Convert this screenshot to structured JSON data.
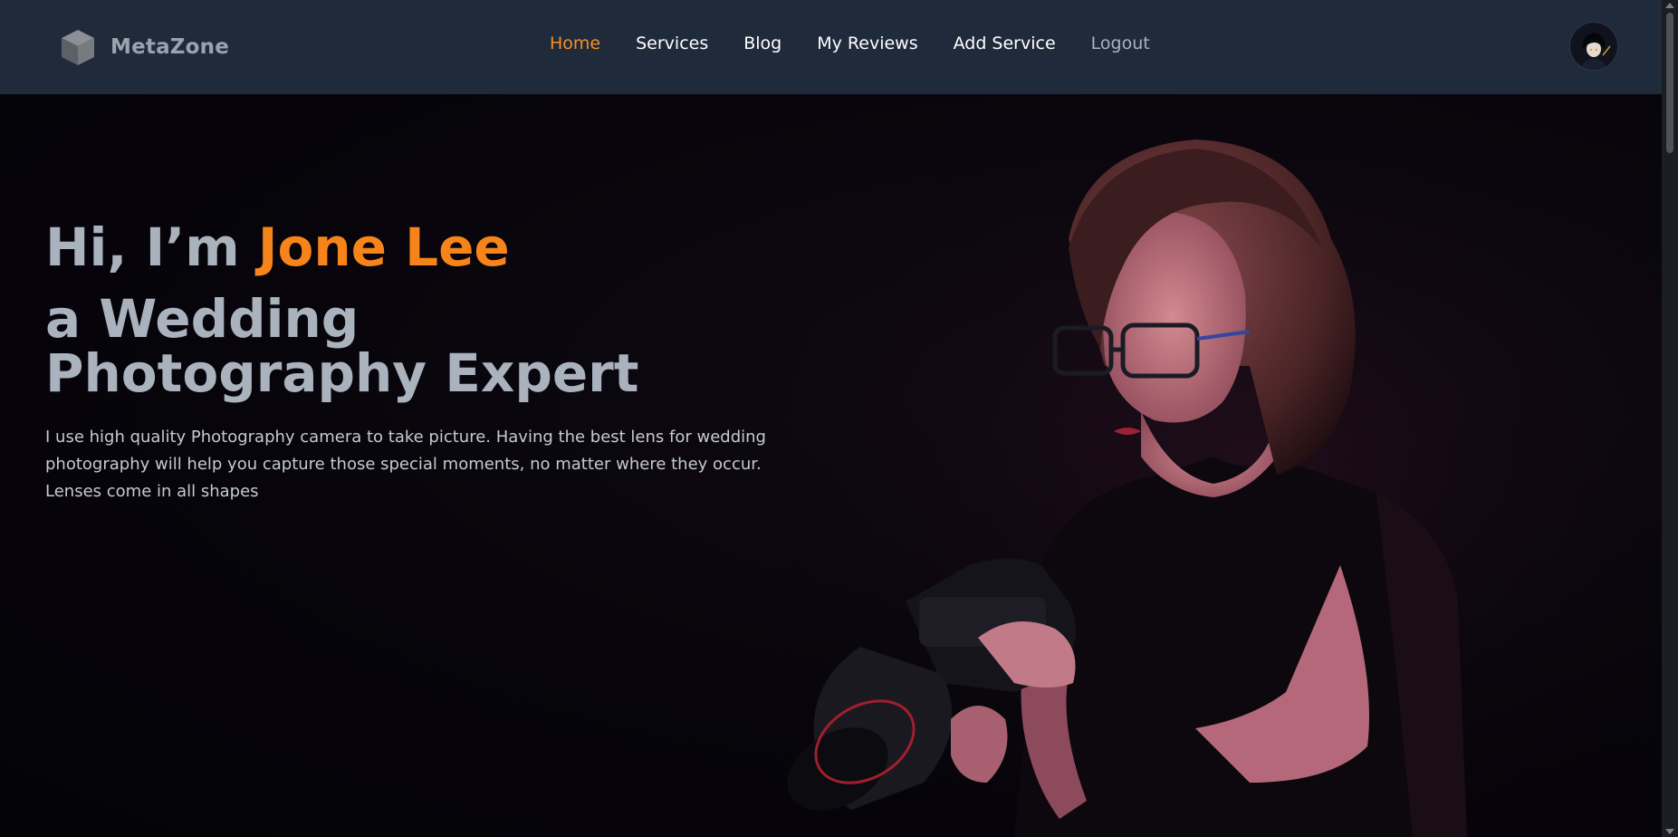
{
  "navbar": {
    "brand_name": "MetaZone",
    "brand_icon": "cube-icon",
    "links": [
      {
        "label": "Home",
        "active": true
      },
      {
        "label": "Services"
      },
      {
        "label": "Blog"
      },
      {
        "label": "My Reviews"
      },
      {
        "label": "Add Service"
      },
      {
        "label": "Logout"
      }
    ],
    "avatar_icon": "user-avatar"
  },
  "hero": {
    "greeting": "Hi, I’m ",
    "name": "Jone Lee",
    "title": "a Wedding Photography Expert",
    "description": "I use high quality Photography camera to take picture. Having the best lens for wedding photography will help you capture those special moments, no matter where they occur. Lenses come in all shapes"
  },
  "colors": {
    "accent": "#f7841a",
    "nav_bg": "#1f2a3b",
    "hero_bg": "#06040a",
    "heading": "#a9b2bd"
  }
}
